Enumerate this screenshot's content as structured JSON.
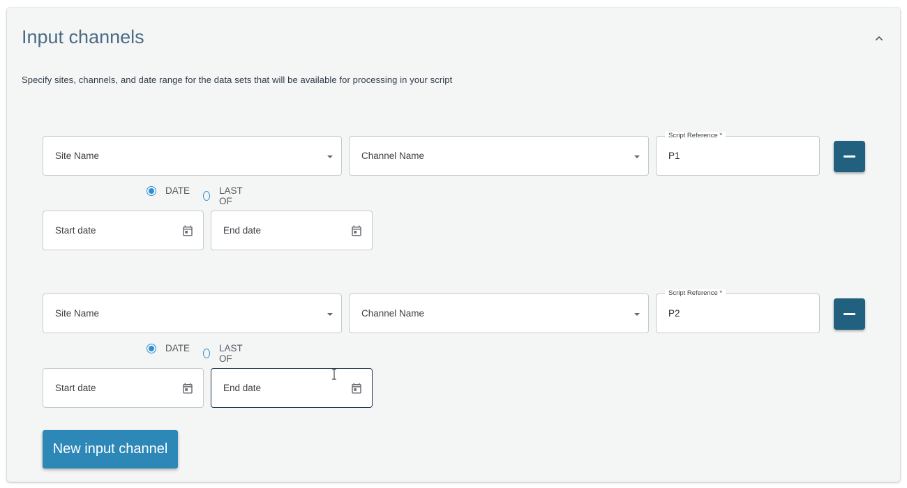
{
  "section": {
    "title": "Input channels",
    "description": "Specify sites, channels, and date range for the data sets that will be available for processing in your script",
    "collapse_icon": "chevron-up-icon"
  },
  "channels": [
    {
      "site_name_label": "Site Name",
      "channel_name_label": "Channel Name",
      "script_reference_label": "Script Reference *",
      "script_reference_value": "P1",
      "radio_date_label": "DATE",
      "radio_last_of_label": "LAST OF",
      "selected_mode": "DATE",
      "start_date_label": "Start date",
      "end_date_label": "End date"
    },
    {
      "site_name_label": "Site Name",
      "channel_name_label": "Channel Name",
      "script_reference_label": "Script Reference *",
      "script_reference_value": "P2",
      "radio_date_label": "DATE",
      "radio_last_of_label": "LAST OF",
      "selected_mode": "DATE",
      "start_date_label": "Start date",
      "end_date_label": "End date"
    }
  ],
  "new_channel_button": "New input channel",
  "colors": {
    "panel_background": "#f4f6f6",
    "title": "#4a6b84",
    "remove_button": "#21607f",
    "new_button": "#2d88b8",
    "radio_accent": "#2d8fd4"
  }
}
